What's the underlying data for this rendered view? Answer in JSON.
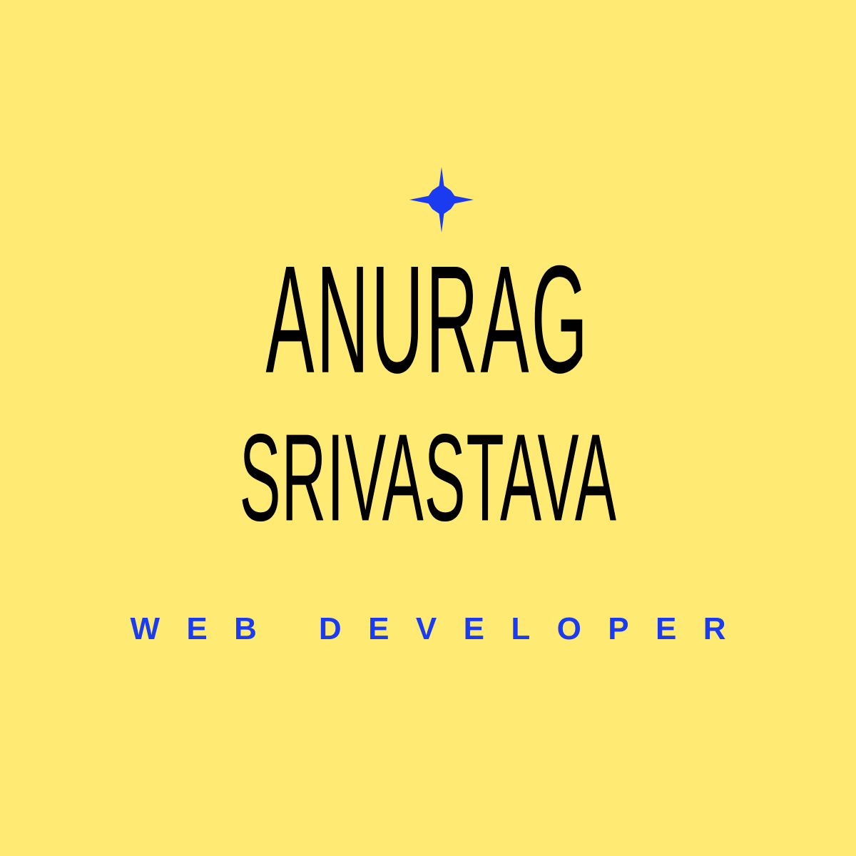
{
  "colors": {
    "background": "#ffeb73",
    "name_text": "#000000",
    "accent": "#1a3bf0"
  },
  "decoration": {
    "icon": "four-point-star-icon"
  },
  "name": {
    "first": "ANURAG",
    "last": "SRIVASTAVA"
  },
  "role": "WEB DEVELOPER"
}
